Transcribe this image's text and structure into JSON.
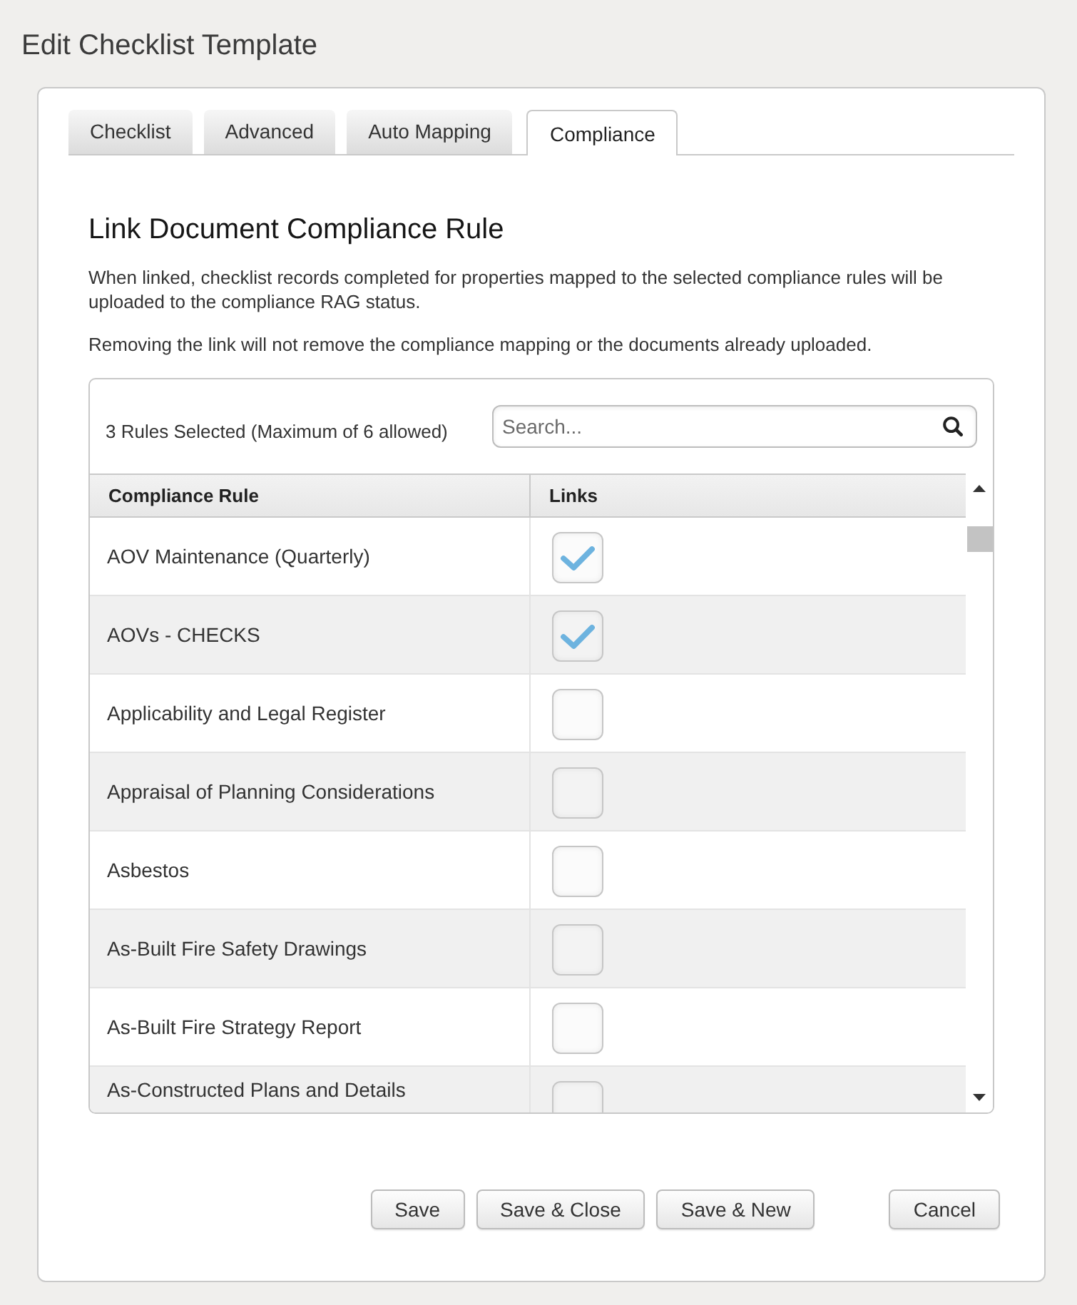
{
  "page": {
    "title": "Edit Checklist Template"
  },
  "tabs": [
    {
      "label": "Checklist",
      "selected": false
    },
    {
      "label": "Advanced",
      "selected": false
    },
    {
      "label": "Auto Mapping",
      "selected": false
    },
    {
      "label": "Compliance",
      "selected": true
    }
  ],
  "section": {
    "heading": "Link Document Compliance Rule",
    "paragraphs": [
      "When linked, checklist records completed for properties mapped to the selected compliance rules will be uploaded to the compliance RAG status.",
      "Removing the link will not remove the compliance mapping or the documents already uploaded."
    ]
  },
  "rules_panel": {
    "selection_summary": "3 Rules Selected (Maximum of 6 allowed)",
    "search": {
      "placeholder": "Search..."
    },
    "table": {
      "columns": [
        "Compliance Rule",
        "Links"
      ],
      "rows": [
        {
          "rule": "AOV Maintenance (Quarterly)",
          "checked": true
        },
        {
          "rule": "AOVs - CHECKS",
          "checked": true
        },
        {
          "rule": "Applicability and Legal Register",
          "checked": false
        },
        {
          "rule": "Appraisal of Planning Considerations",
          "checked": false
        },
        {
          "rule": "Asbestos",
          "checked": false
        },
        {
          "rule": "As-Built Fire Safety Drawings",
          "checked": false
        },
        {
          "rule": "As-Built Fire Strategy Report",
          "checked": false
        },
        {
          "rule": "As-Constructed Plans and Details",
          "checked": false
        }
      ]
    }
  },
  "buttons": [
    {
      "label": "Save",
      "kind": "action"
    },
    {
      "label": "Save & Close",
      "kind": "action"
    },
    {
      "label": "Save & New",
      "kind": "action"
    },
    {
      "label": "Cancel",
      "kind": "cancel"
    }
  ]
}
